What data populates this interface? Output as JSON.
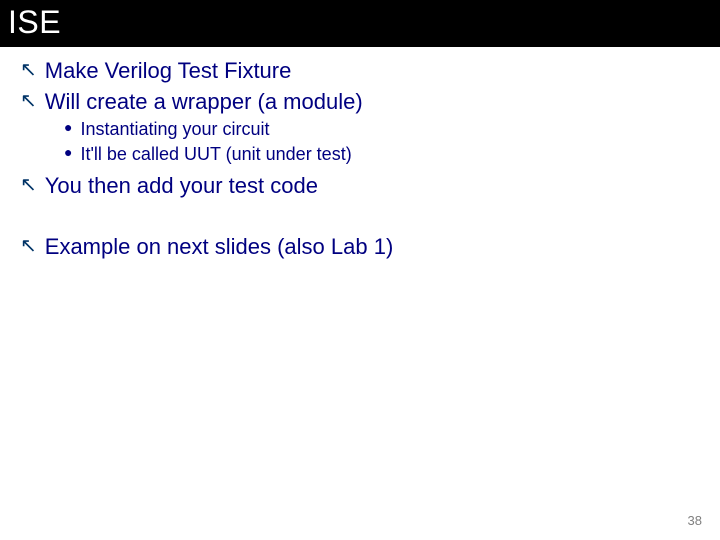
{
  "title": "ISE",
  "bullets": [
    {
      "level": 1,
      "text": "Make Verilog Test Fixture"
    },
    {
      "level": 1,
      "text": "Will create a wrapper (a module)"
    },
    {
      "level": 2,
      "text": "Instantiating your circuit"
    },
    {
      "level": 2,
      "text": "It'll be called UUT (unit under test)"
    },
    {
      "level": 1,
      "text": "You then add your test code"
    },
    {
      "level": 0,
      "text": ""
    },
    {
      "level": 1,
      "text": "Example on next slides (also Lab 1)"
    }
  ],
  "glyphs": {
    "level1": "↖",
    "level2": "●"
  },
  "page_number": "38"
}
